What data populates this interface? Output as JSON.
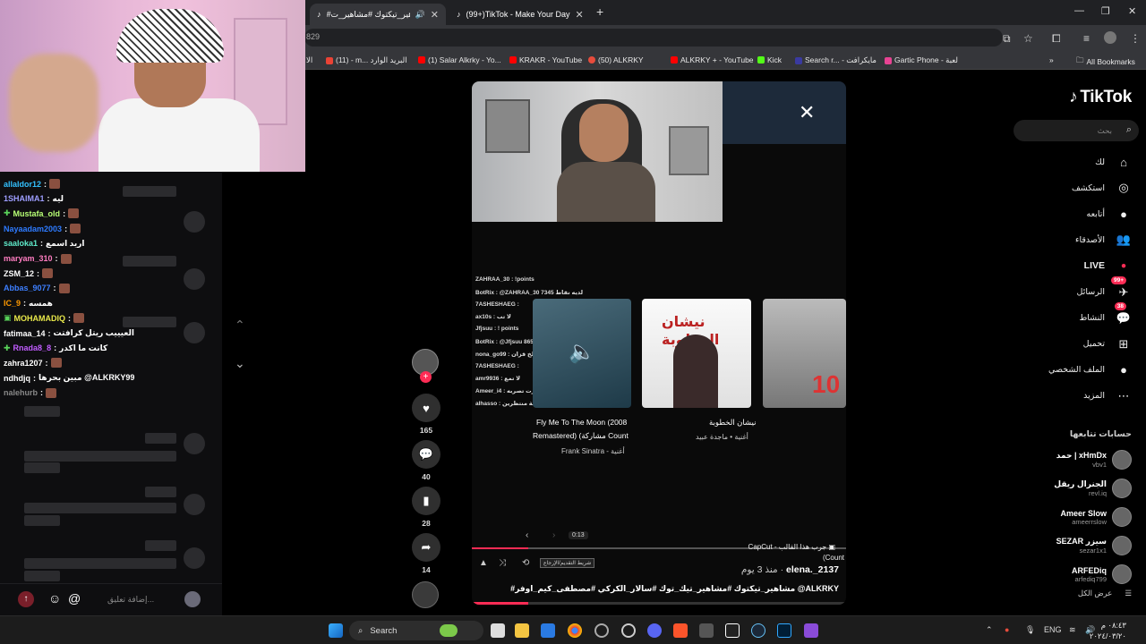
{
  "browser": {
    "tabs": [
      {
        "label": "#مشاهير_تيكتوك #مشاهير_ت...",
        "active": true
      },
      {
        "label": "(99+)TikTok - Make Your Day",
        "active": false
      }
    ],
    "new_tab": "+",
    "url_fragment": "829",
    "bookmarks": [
      {
        "label": "الا",
        "color": "#4a90e2"
      },
      {
        "label": "(11) - m... البريد الوارد",
        "color": "#ea4335"
      },
      {
        "label": "(1) Salar Alkrky - Yo...",
        "color": "#ff0000"
      },
      {
        "label": "KRAKR - YouTube",
        "color": "#ff0000"
      },
      {
        "label": "(50) ALKRKY",
        "color": "#e74c3c"
      },
      {
        "label": "ALKRKY + - YouTube",
        "color": "#ff0000"
      },
      {
        "label": "Kick",
        "color": "#53fc18"
      },
      {
        "label": "Search r... - مايكرافت",
        "color": "#3a3aa0"
      },
      {
        "label": "Gartic Phone - لعبة",
        "color": "#e84393"
      }
    ],
    "all_bookmarks": "All Bookmarks",
    "overflow": "»"
  },
  "chat": {
    "messages": [
      {
        "user": "allaldor12",
        "color": "#33c1ff",
        "text": ""
      },
      {
        "user": "1SHAIMA1",
        "color": "#9e9eff",
        "text": "ليه"
      },
      {
        "user": "Mustafa_old",
        "color": "#b8ff75",
        "text": "",
        "badge": "✚"
      },
      {
        "user": "Nayaadam2003",
        "color": "#2e7bff",
        "text": ""
      },
      {
        "user": "saaloka1",
        "color": "#5ee9c9",
        "text": "اريد اسمع"
      },
      {
        "user": "maryam_310",
        "color": "#ff7dc1",
        "text": ""
      },
      {
        "user": "ZSM_12",
        "color": "#ffffff",
        "text": ""
      },
      {
        "user": "Abbas_9077",
        "color": "#3d7fff",
        "text": ""
      },
      {
        "user": "IC_9",
        "color": "#ff9900",
        "text": "همسه"
      },
      {
        "user": "MOHAMADIQ",
        "color": "#e8e84a",
        "text": "",
        "badge": "▣"
      },
      {
        "user": "fatimaa_14",
        "color": "#ffffff",
        "text": "العيييب ريتل كرافتت"
      },
      {
        "user": "Rnada8_8",
        "color": "#c15cff",
        "text": "كانت ما اكدر",
        "badge": "✚"
      },
      {
        "user": "zahra1207",
        "color": "#ffffff",
        "text": ""
      },
      {
        "user": "ndhdjq",
        "color": "#ffffff",
        "text": "مبين بحرها @ALKRKY99"
      },
      {
        "user": "nalehurb",
        "color": "#888888",
        "text": ""
      }
    ],
    "input_placeholder": "إضافة تعليق...",
    "at_icon": "@"
  },
  "video": {
    "songs": [
      {
        "title": "Fly Me To The Moon (2008",
        "sub": "Remastered) (مشاركة Count",
        "artist": "Frank Sinatra - أغنية"
      },
      {
        "title": "نيشان الخطوبة",
        "sub": "أغنية • ماجدة عبيد",
        "artist": ""
      }
    ],
    "card2_title": "نيشان الخطوبة",
    "card3_number": "10",
    "time": "0:13",
    "tooltip": "شريط التقديم/الإرجاع",
    "capcut": "CapCut - جرب هذا القالب",
    "count_label": "(Count",
    "author": "elena._2137",
    "date": "منذ 3 يوم ·",
    "caption": "#مشاهير_تيكتوك #مشاهير_تيك_توك #سالار_الكركي #مصطفى_كيم_اوفر @ALKRKY",
    "progress_fraction": 0.3,
    "chat_lines": [
      "ZAHRAA_30 : !points",
      "BotRix : @ZAHRAA_30 7345 لديه نقاط",
      "7ASHESHAEG :",
      "ax10s : لا تب",
      "Jfjsuu : ! points",
      "BotRix : @Jfjsuu 8650 لديه نقاط",
      "nona_go99 : طخ قزان",
      "7ASHESHAEG :",
      "amr9936 : لا تمع",
      "Ameer_i4 : لا تتبرت تصربه",
      "alhasso : علي تسلمن صارتي ساعة منتظرين"
    ]
  },
  "actions": {
    "likes": "165",
    "comments": "40",
    "saves": "28",
    "shares": "14"
  },
  "tiktok": {
    "logo": "TikTok",
    "search_placeholder": "بحث",
    "nav": [
      {
        "label": "لك",
        "icon": "⌂"
      },
      {
        "label": "استكشف",
        "icon": "◎"
      },
      {
        "label": "أتابعه",
        "icon": "●"
      },
      {
        "label": "الأصدقاء",
        "icon": "👥"
      },
      {
        "label": "LIVE",
        "icon": "●"
      },
      {
        "label": "الرسائل",
        "icon": "✈",
        "badge": "99+"
      },
      {
        "label": "النشاط",
        "icon": "💬",
        "badge": "38"
      },
      {
        "label": "تحميل",
        "icon": "⊞"
      },
      {
        "label": "الملف الشخصي",
        "icon": "●"
      },
      {
        "label": "المزيد",
        "icon": "⋯"
      }
    ],
    "following_title": "حسابات تتابعها",
    "following": [
      {
        "name": "حمد | xHmDx",
        "handle": "vbv1"
      },
      {
        "name": "الجنرال ريقل",
        "handle": "revl.iq"
      },
      {
        "name": "Ameer Slow",
        "handle": "ameerrslow"
      },
      {
        "name": "SEZAR سيزر",
        "handle": "sezar1x1"
      },
      {
        "name": "ARFEDiq",
        "handle": "arfediq799"
      }
    ],
    "see_all": "عرض الكل"
  },
  "taskbar": {
    "search": "Search",
    "lang": "ENG",
    "time": "٠٨:٤٣ م",
    "date": "٢٠٢٤/٠٣/٢٠"
  }
}
